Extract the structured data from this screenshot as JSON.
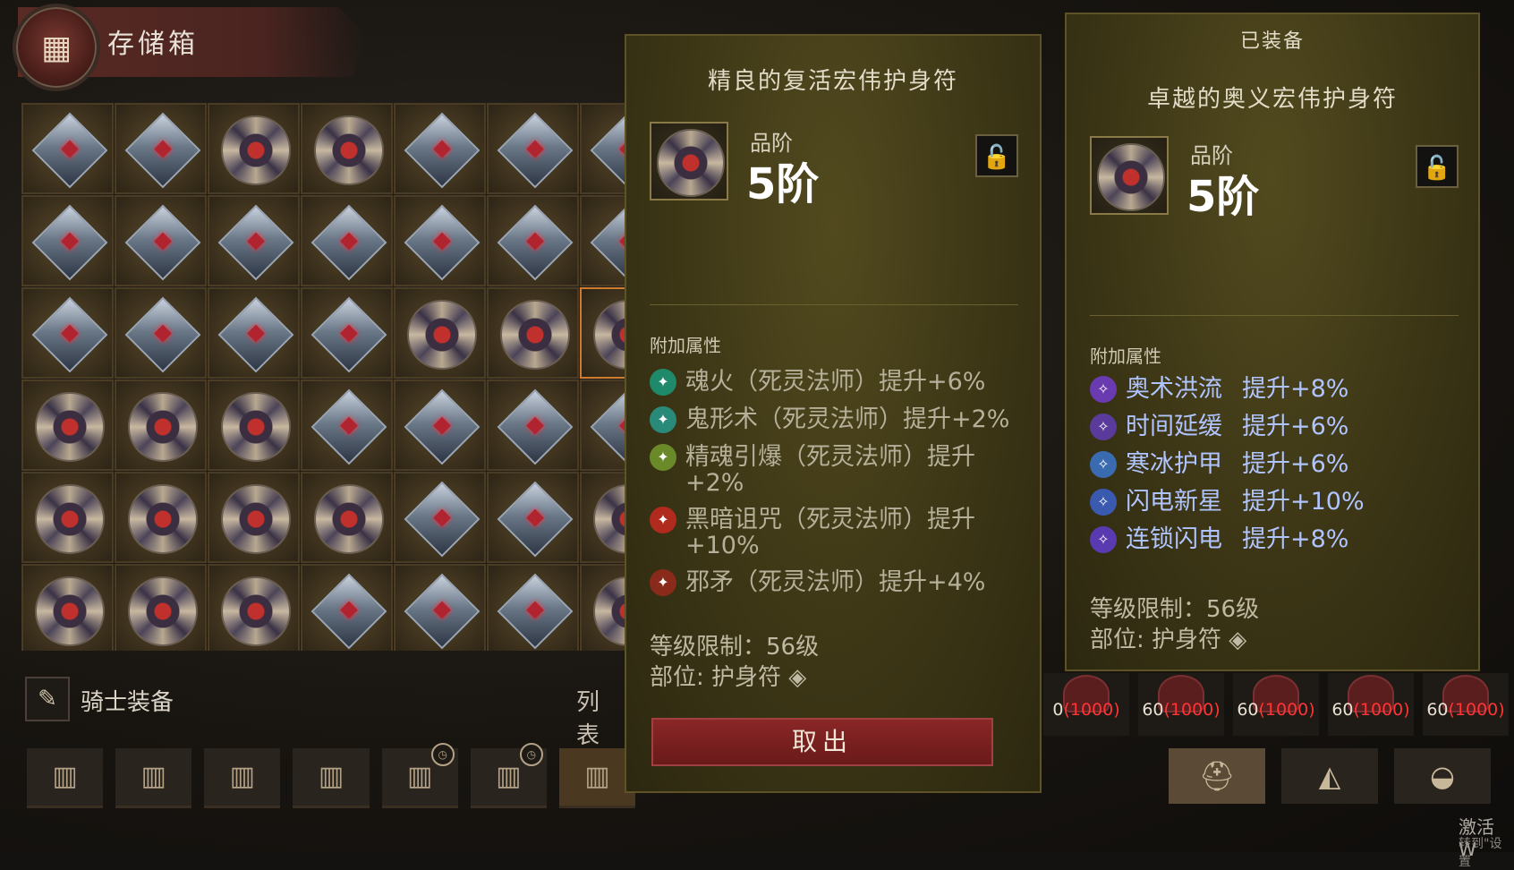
{
  "storage": {
    "title": "存储箱",
    "knight_label": "骑士装备",
    "list_label": "列表",
    "grid": [
      [
        "diamond",
        "diamond",
        "round",
        "round",
        "diamond",
        "diamond",
        "diamond"
      ],
      [
        "diamond",
        "diamond",
        "diamond",
        "diamond",
        "diamond",
        "diamond",
        "diamond"
      ],
      [
        "diamond",
        "diamond",
        "diamond",
        "diamond",
        "round",
        "round",
        "round"
      ],
      [
        "round",
        "round",
        "round",
        "diamond",
        "diamond",
        "diamond",
        "diamond"
      ],
      [
        "round",
        "round",
        "round",
        "round",
        "diamond",
        "diamond",
        "round"
      ],
      [
        "round",
        "round",
        "round",
        "diamond",
        "diamond",
        "diamond",
        "round"
      ]
    ],
    "tabs": [
      {
        "icon": "chest-icon",
        "timer": false
      },
      {
        "icon": "chest-icon",
        "timer": false
      },
      {
        "icon": "chest-icon",
        "timer": false
      },
      {
        "icon": "chest-icon",
        "timer": false
      },
      {
        "icon": "ornate-chest-icon",
        "timer": true
      },
      {
        "icon": "ornate-chest-icon",
        "timer": true
      },
      {
        "icon": "ornate-chest-icon",
        "timer": false
      }
    ]
  },
  "item_tooltip": {
    "name": "精良的复活宏伟护身符",
    "tier_label": "品阶",
    "tier_value": "5阶",
    "attr_label": "附加属性",
    "affixes": [
      {
        "text": "魂火（死灵法师）提升+6%",
        "icon_color": "#1e8a6a"
      },
      {
        "text": "鬼形术（死灵法师）提升+2%",
        "icon_color": "#2a8a7a"
      },
      {
        "text": "精魂引爆（死灵法师）提升",
        "text2": "+2%",
        "icon_color": "#6a8a2a"
      },
      {
        "text": "黑暗诅咒（死灵法师）提升",
        "text2": "+10%",
        "icon_color": "#b02a1e"
      },
      {
        "text": "邪矛（死灵法师）提升+4%",
        "icon_color": "#8a2a1a"
      }
    ],
    "level_req": "等级限制：56级",
    "slot": "部位: 护身符",
    "take_button": "取出"
  },
  "equipped_tooltip": {
    "header": "已装备",
    "name": "卓越的奥义宏伟护身符",
    "tier_label": "品阶",
    "tier_value": "5阶",
    "attr_label": "附加属性",
    "affixes": [
      {
        "name": "奥术洪流",
        "value": "提升+8%",
        "icon_color": "#6a3ab0"
      },
      {
        "name": "时间延缓",
        "value": "提升+6%",
        "icon_color": "#5a3a9a"
      },
      {
        "name": "寒冰护甲",
        "value": "提升+6%",
        "icon_color": "#3a6ab0"
      },
      {
        "name": "闪电新星",
        "value": "提升+10%",
        "icon_color": "#3a5ab0"
      },
      {
        "name": "连锁闪电",
        "value": "提升+8%",
        "icon_color": "#5a3ab0"
      }
    ],
    "level_req": "等级限制：56级",
    "slot": "部位: 护身符"
  },
  "right_slots": [
    {
      "level": "0",
      "cap": "(1000)"
    },
    {
      "level": "60",
      "cap": "(1000)"
    },
    {
      "level": "60",
      "cap": "(1000)"
    },
    {
      "level": "60",
      "cap": "(1000)"
    },
    {
      "level": "60",
      "cap": "(1000)"
    }
  ],
  "right_tabs": [
    "helmet-icon",
    "stone-icon",
    "bag-icon"
  ],
  "watermark": {
    "line1": "激活 W",
    "line2": "转到\"设置"
  }
}
